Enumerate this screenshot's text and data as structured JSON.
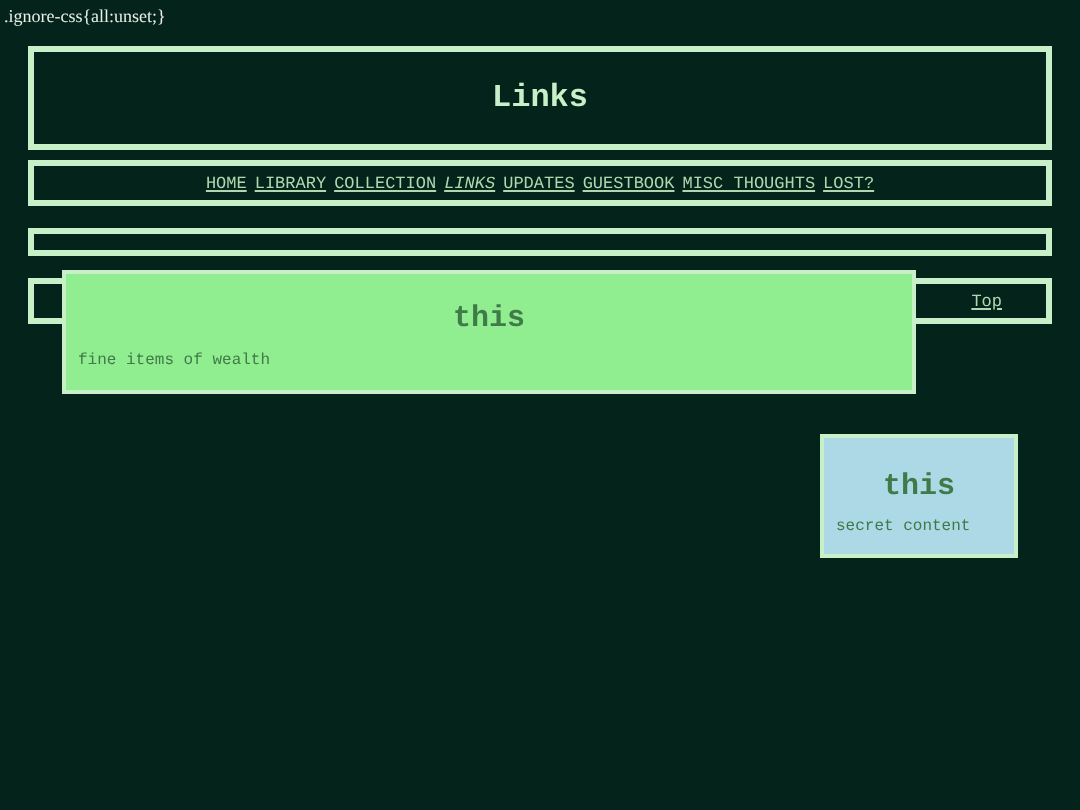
{
  "code_note": ".ignore-css{all:unset;}",
  "header": {
    "title": "Links"
  },
  "nav": [
    {
      "label": "HOME",
      "selected": false
    },
    {
      "label": "LIBRARY",
      "selected": false
    },
    {
      "label": "COLLECTION",
      "selected": false
    },
    {
      "label": "LINKS",
      "selected": true
    },
    {
      "label": "UPDATES",
      "selected": false
    },
    {
      "label": "GUESTBOOK",
      "selected": false
    },
    {
      "label": "MISC THOUGHTS",
      "selected": false
    },
    {
      "label": "LOST?",
      "selected": false
    }
  ],
  "top_link": "Top",
  "popups": [
    {
      "title": "this",
      "text": "fine items of wealth",
      "color": "#90ee90"
    },
    {
      "title": "this",
      "text": "secret content",
      "color": "#add8e6"
    }
  ]
}
